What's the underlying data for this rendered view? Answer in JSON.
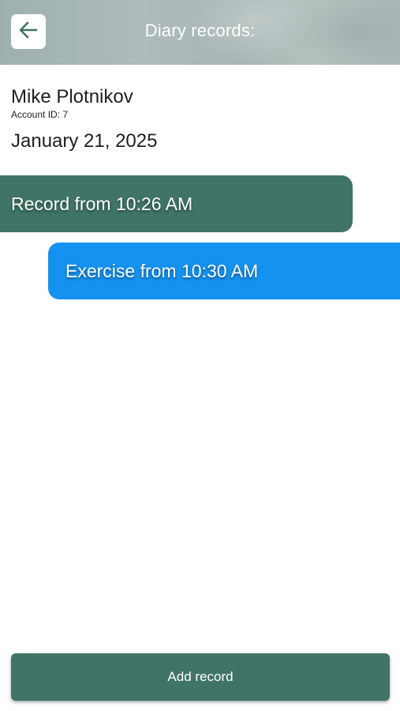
{
  "header": {
    "title": "Diary records:",
    "back_icon": "arrow-left-icon",
    "accent_color": "#3f7466"
  },
  "user": {
    "name": "Mike Plotnikov",
    "account_id": "Account ID: 7"
  },
  "date": "January 21, 2025",
  "entries": [
    {
      "label": "Record from 10:26 AM",
      "type": "record",
      "color": "#3f7466"
    },
    {
      "label": "Exercise from 10:30 AM",
      "type": "exercise",
      "color": "#1591ef"
    }
  ],
  "footer": {
    "add_record_label": "Add record"
  }
}
